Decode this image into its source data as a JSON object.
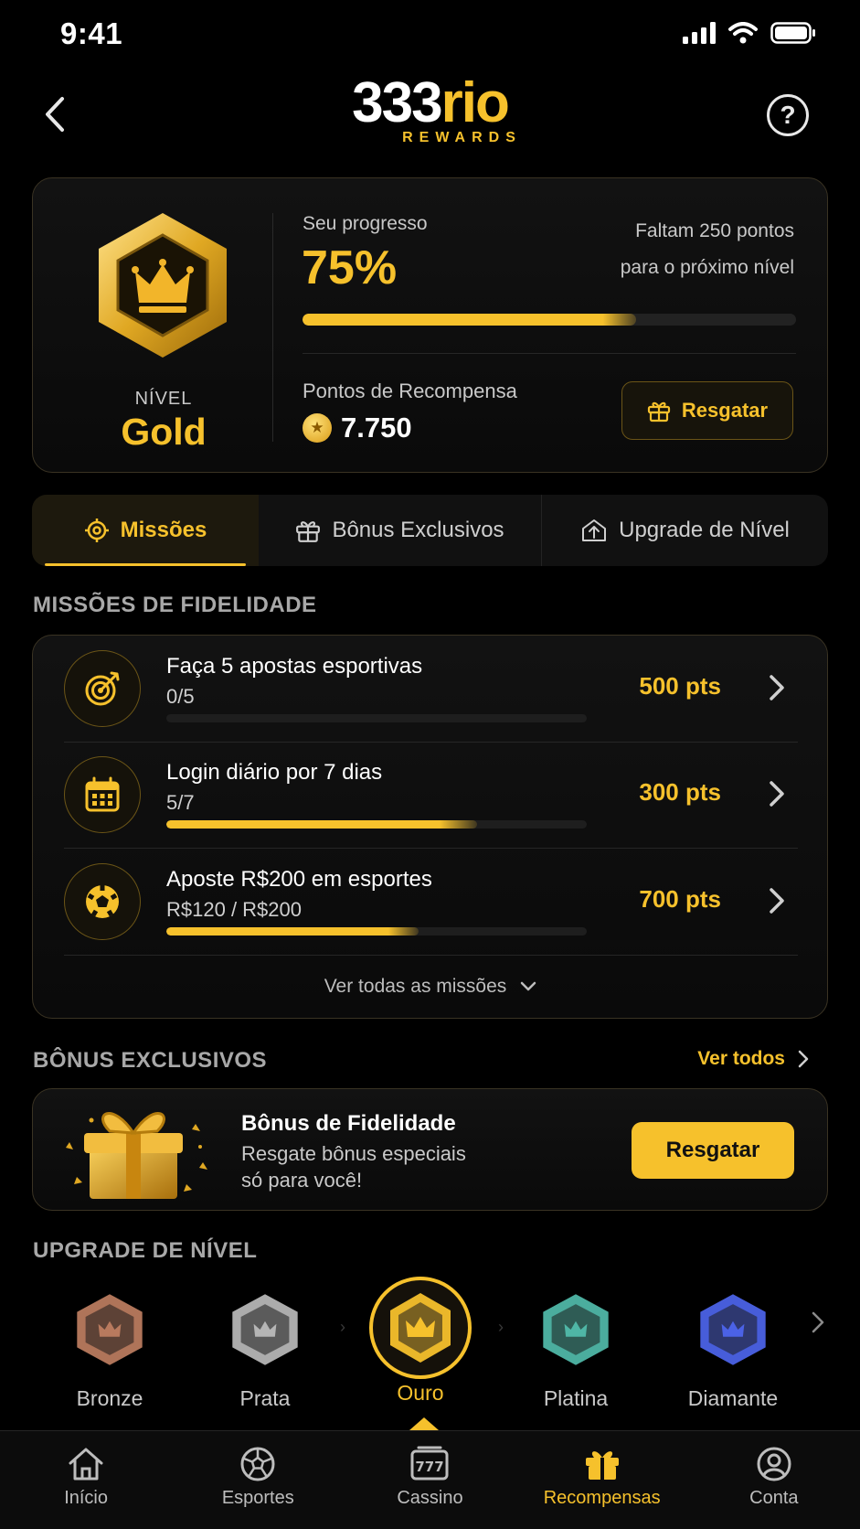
{
  "status_bar": {
    "time": "9:41"
  },
  "header": {
    "logo_num": "333",
    "logo_word": "rio",
    "logo_sub": "REWARDS",
    "help_label": "?"
  },
  "level_card": {
    "level_label": "NÍVEL",
    "level_name": "Gold",
    "progress_label": "Seu progresso",
    "progress_value": "75%",
    "progress_fraction": 0.75,
    "remaining_line1": "Faltam 250 pontos",
    "remaining_line2": "para o próximo nível",
    "points_label": "Pontos de Recompensa",
    "points_value": "7.750",
    "redeem_label": "Resgatar"
  },
  "tabs": [
    {
      "label": "Missões",
      "active": true
    },
    {
      "label": "Bônus Exclusivos",
      "active": false
    },
    {
      "label": "Upgrade de Nível",
      "active": false
    }
  ],
  "missions": {
    "section_title": "MISSÕES DE FIDELIDADE",
    "items": [
      {
        "title": "Faça 5 apostas esportivas",
        "progress_text": "0/5",
        "progress": 0.0,
        "points": "500 pts",
        "icon": "target-icon"
      },
      {
        "title": "Login diário por 7 dias",
        "progress_text": "5/7",
        "progress": 0.74,
        "points": "300 pts",
        "icon": "calendar-icon"
      },
      {
        "title": "Aposte R$200 em esportes",
        "progress_text": "R$120 / R$200",
        "progress": 0.6,
        "points": "700 pts",
        "icon": "soccer-ball-icon"
      }
    ],
    "see_all": "Ver todas as missões"
  },
  "bonus": {
    "section_title": "BÔNUS EXCLUSIVOS",
    "see_all": "Ver todos",
    "title": "Bônus de Fidelidade",
    "desc_line1": "Resgate bônus especiais",
    "desc_line2": "só para você!",
    "button": "Resgatar"
  },
  "upgrade": {
    "section_title": "UPGRADE DE NÍVEL",
    "tiers": [
      {
        "name": "Bronze",
        "color": "#b87a5e"
      },
      {
        "name": "Prata",
        "color": "#b5b5b5"
      },
      {
        "name": "Ouro",
        "color": "#f6c12c"
      },
      {
        "name": "Platina",
        "color": "#4fb6a6"
      },
      {
        "name": "Diamante",
        "color": "#4b62e6"
      }
    ]
  },
  "bottom_nav": [
    {
      "label": "Início",
      "icon": "home-icon",
      "active": false
    },
    {
      "label": "Esportes",
      "icon": "soccer-ball-icon",
      "active": false
    },
    {
      "label": "Cassino",
      "icon": "slot-machine-icon",
      "active": false
    },
    {
      "label": "Recompensas",
      "icon": "gift-icon",
      "active": true
    },
    {
      "label": "Conta",
      "icon": "user-circle-icon",
      "active": false
    }
  ],
  "colors": {
    "accent": "#f6c12c",
    "background": "#000000",
    "card": "#111111"
  }
}
